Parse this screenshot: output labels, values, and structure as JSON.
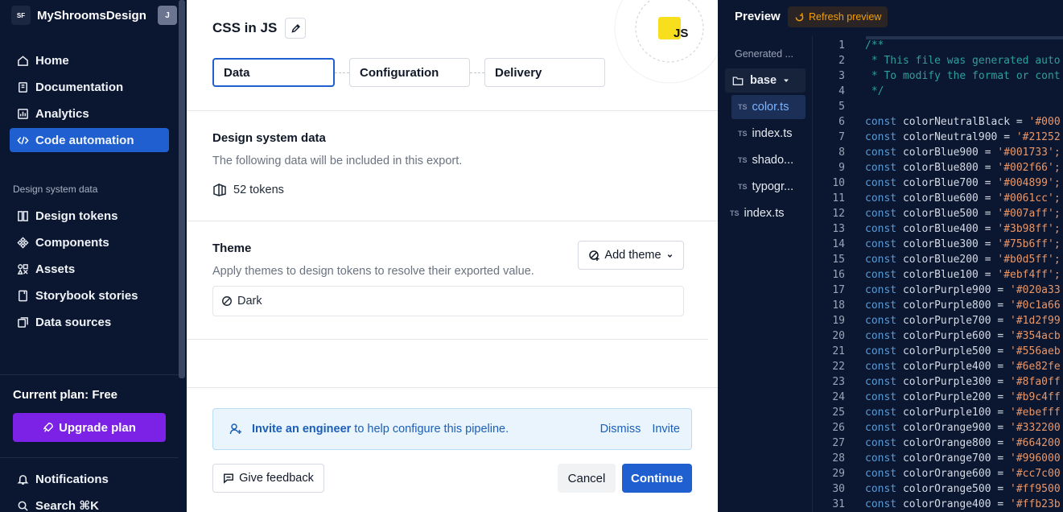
{
  "sidebar": {
    "logo": "SF",
    "app_name": "MyShroomsDesign",
    "avatar": "J",
    "nav": [
      {
        "label": "Home",
        "icon": "home-icon"
      },
      {
        "label": "Documentation",
        "icon": "book-icon"
      },
      {
        "label": "Analytics",
        "icon": "analytics-icon"
      },
      {
        "label": "Code automation",
        "icon": "code-icon",
        "active": true
      }
    ],
    "section_label": "Design system data",
    "data_nav": [
      {
        "label": "Design tokens",
        "icon": "tokens-icon"
      },
      {
        "label": "Components",
        "icon": "components-icon"
      },
      {
        "label": "Assets",
        "icon": "assets-icon"
      },
      {
        "label": "Storybook stories",
        "icon": "storybook-icon"
      },
      {
        "label": "Data sources",
        "icon": "data-sources-icon"
      }
    ],
    "plan": "Current plan: Free",
    "upgrade": "Upgrade plan",
    "bottom": [
      {
        "label": "Notifications",
        "icon": "bell-icon"
      },
      {
        "label": "Search ⌘K",
        "icon": "search-icon"
      }
    ]
  },
  "main": {
    "title": "CSS in JS",
    "badge": "JS",
    "steps": [
      "Data",
      "Configuration",
      "Delivery"
    ],
    "ds_title": "Design system data",
    "ds_sub": "The following data will be included in this export.",
    "tokens": "52 tokens",
    "theme_title": "Theme",
    "theme_sub": "Apply themes to design tokens to resolve their exported value.",
    "add_theme": "Add theme",
    "theme_item": "Dark",
    "invite_strong": "Invite an engineer",
    "invite_text": "to help configure this pipeline.",
    "dismiss": "Dismiss",
    "invite": "Invite",
    "feedback": "Give feedback",
    "cancel": "Cancel",
    "continue": "Continue"
  },
  "preview": {
    "title": "Preview",
    "refresh": "Refresh preview",
    "tree": {
      "root": "Generated ...",
      "folder": "base",
      "files": [
        "color.ts",
        "index.ts",
        "shado...",
        "typogr..."
      ],
      "root_file": "index.ts"
    },
    "code": [
      {
        "n": "1",
        "t": "/**",
        "c": "cm"
      },
      {
        "n": "2",
        "t": " * This file was generated auto",
        "c": "cm"
      },
      {
        "n": "3",
        "t": " * To modify the format or cont",
        "c": "cm"
      },
      {
        "n": "4",
        "t": " */",
        "c": "cm"
      },
      {
        "n": "5",
        "t": "",
        "c": ""
      },
      {
        "n": "6",
        "k": "const",
        "v": " colorNeutralBlack = ",
        "s": "'#000"
      },
      {
        "n": "7",
        "k": "const",
        "v": " colorNeutral900 = ",
        "s": "'#21252"
      },
      {
        "n": "8",
        "k": "const",
        "v": " colorBlue900 = ",
        "s": "'#001733';"
      },
      {
        "n": "9",
        "k": "const",
        "v": " colorBlue800 = ",
        "s": "'#002f66';"
      },
      {
        "n": "10",
        "k": "const",
        "v": " colorBlue700 = ",
        "s": "'#004899';"
      },
      {
        "n": "11",
        "k": "const",
        "v": " colorBlue600 = ",
        "s": "'#0061cc';"
      },
      {
        "n": "12",
        "k": "const",
        "v": " colorBlue500 = ",
        "s": "'#007aff';"
      },
      {
        "n": "13",
        "k": "const",
        "v": " colorBlue400 = ",
        "s": "'#3b98ff';"
      },
      {
        "n": "14",
        "k": "const",
        "v": " colorBlue300 = ",
        "s": "'#75b6ff';"
      },
      {
        "n": "15",
        "k": "const",
        "v": " colorBlue200 = ",
        "s": "'#b0d5ff';"
      },
      {
        "n": "16",
        "k": "const",
        "v": " colorBlue100 = ",
        "s": "'#ebf4ff';"
      },
      {
        "n": "17",
        "k": "const",
        "v": " colorPurple900 = ",
        "s": "'#020a33"
      },
      {
        "n": "18",
        "k": "const",
        "v": " colorPurple800 = ",
        "s": "'#0c1a66"
      },
      {
        "n": "19",
        "k": "const",
        "v": " colorPurple700 = ",
        "s": "'#1d2f99"
      },
      {
        "n": "20",
        "k": "const",
        "v": " colorPurple600 = ",
        "s": "'#354acb"
      },
      {
        "n": "21",
        "k": "const",
        "v": " colorPurple500 = ",
        "s": "'#556aeb"
      },
      {
        "n": "22",
        "k": "const",
        "v": " colorPurple400 = ",
        "s": "'#6e82fe"
      },
      {
        "n": "23",
        "k": "const",
        "v": " colorPurple300 = ",
        "s": "'#8fa0ff"
      },
      {
        "n": "24",
        "k": "const",
        "v": " colorPurple200 = ",
        "s": "'#b9c4ff"
      },
      {
        "n": "25",
        "k": "const",
        "v": " colorPurple100 = ",
        "s": "'#ebefff"
      },
      {
        "n": "26",
        "k": "const",
        "v": " colorOrange900 = ",
        "s": "'#332200"
      },
      {
        "n": "27",
        "k": "const",
        "v": " colorOrange800 = ",
        "s": "'#664200"
      },
      {
        "n": "28",
        "k": "const",
        "v": " colorOrange700 = ",
        "s": "'#996000"
      },
      {
        "n": "29",
        "k": "const",
        "v": " colorOrange600 = ",
        "s": "'#cc7c00"
      },
      {
        "n": "30",
        "k": "const",
        "v": " colorOrange500 = ",
        "s": "'#ff9500"
      },
      {
        "n": "31",
        "k": "const",
        "v": " colorOrange400 = ",
        "s": "'#ffb23b"
      }
    ]
  },
  "colors": {
    "sidebar_bg": "#0b1730",
    "accent": "#1f5fd0",
    "upgrade": "#7b22e6",
    "refresh": "#f59e0b",
    "js_badge": "#f7df1e"
  }
}
